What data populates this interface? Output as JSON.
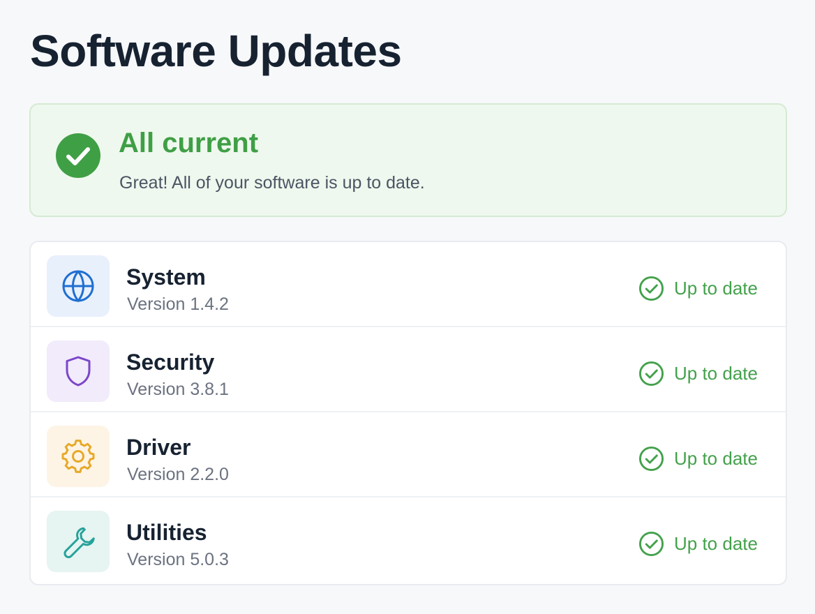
{
  "page": {
    "title": "Software Updates"
  },
  "summary": {
    "heading": "All current",
    "message": "Great! All of your software is up to date.",
    "icon": "check-circle-icon",
    "color": "#43a047"
  },
  "updates": [
    {
      "name": "System",
      "version": "Version 1.4.2",
      "status": "Up to date",
      "icon": "globe-icon",
      "icon_color": "#1f6fd1",
      "icon_bg": "#e8f0fc"
    },
    {
      "name": "Security",
      "version": "Version 3.8.1",
      "status": "Up to date",
      "icon": "shield-icon",
      "icon_color": "#7c46c9",
      "icon_bg": "#f1ebfb"
    },
    {
      "name": "Driver",
      "version": "Version 2.2.0",
      "status": "Up to date",
      "icon": "gear-icon",
      "icon_color": "#e7a928",
      "icon_bg": "#fdf4e6"
    },
    {
      "name": "Utilities",
      "version": "Version 5.0.3",
      "status": "Up to date",
      "icon": "wrench-icon",
      "icon_color": "#26a39a",
      "icon_bg": "#e6f4f2"
    }
  ],
  "colors": {
    "success": "#44a14c",
    "title": "#172231",
    "muted": "#6b7280",
    "border": "#e8ebf0"
  }
}
